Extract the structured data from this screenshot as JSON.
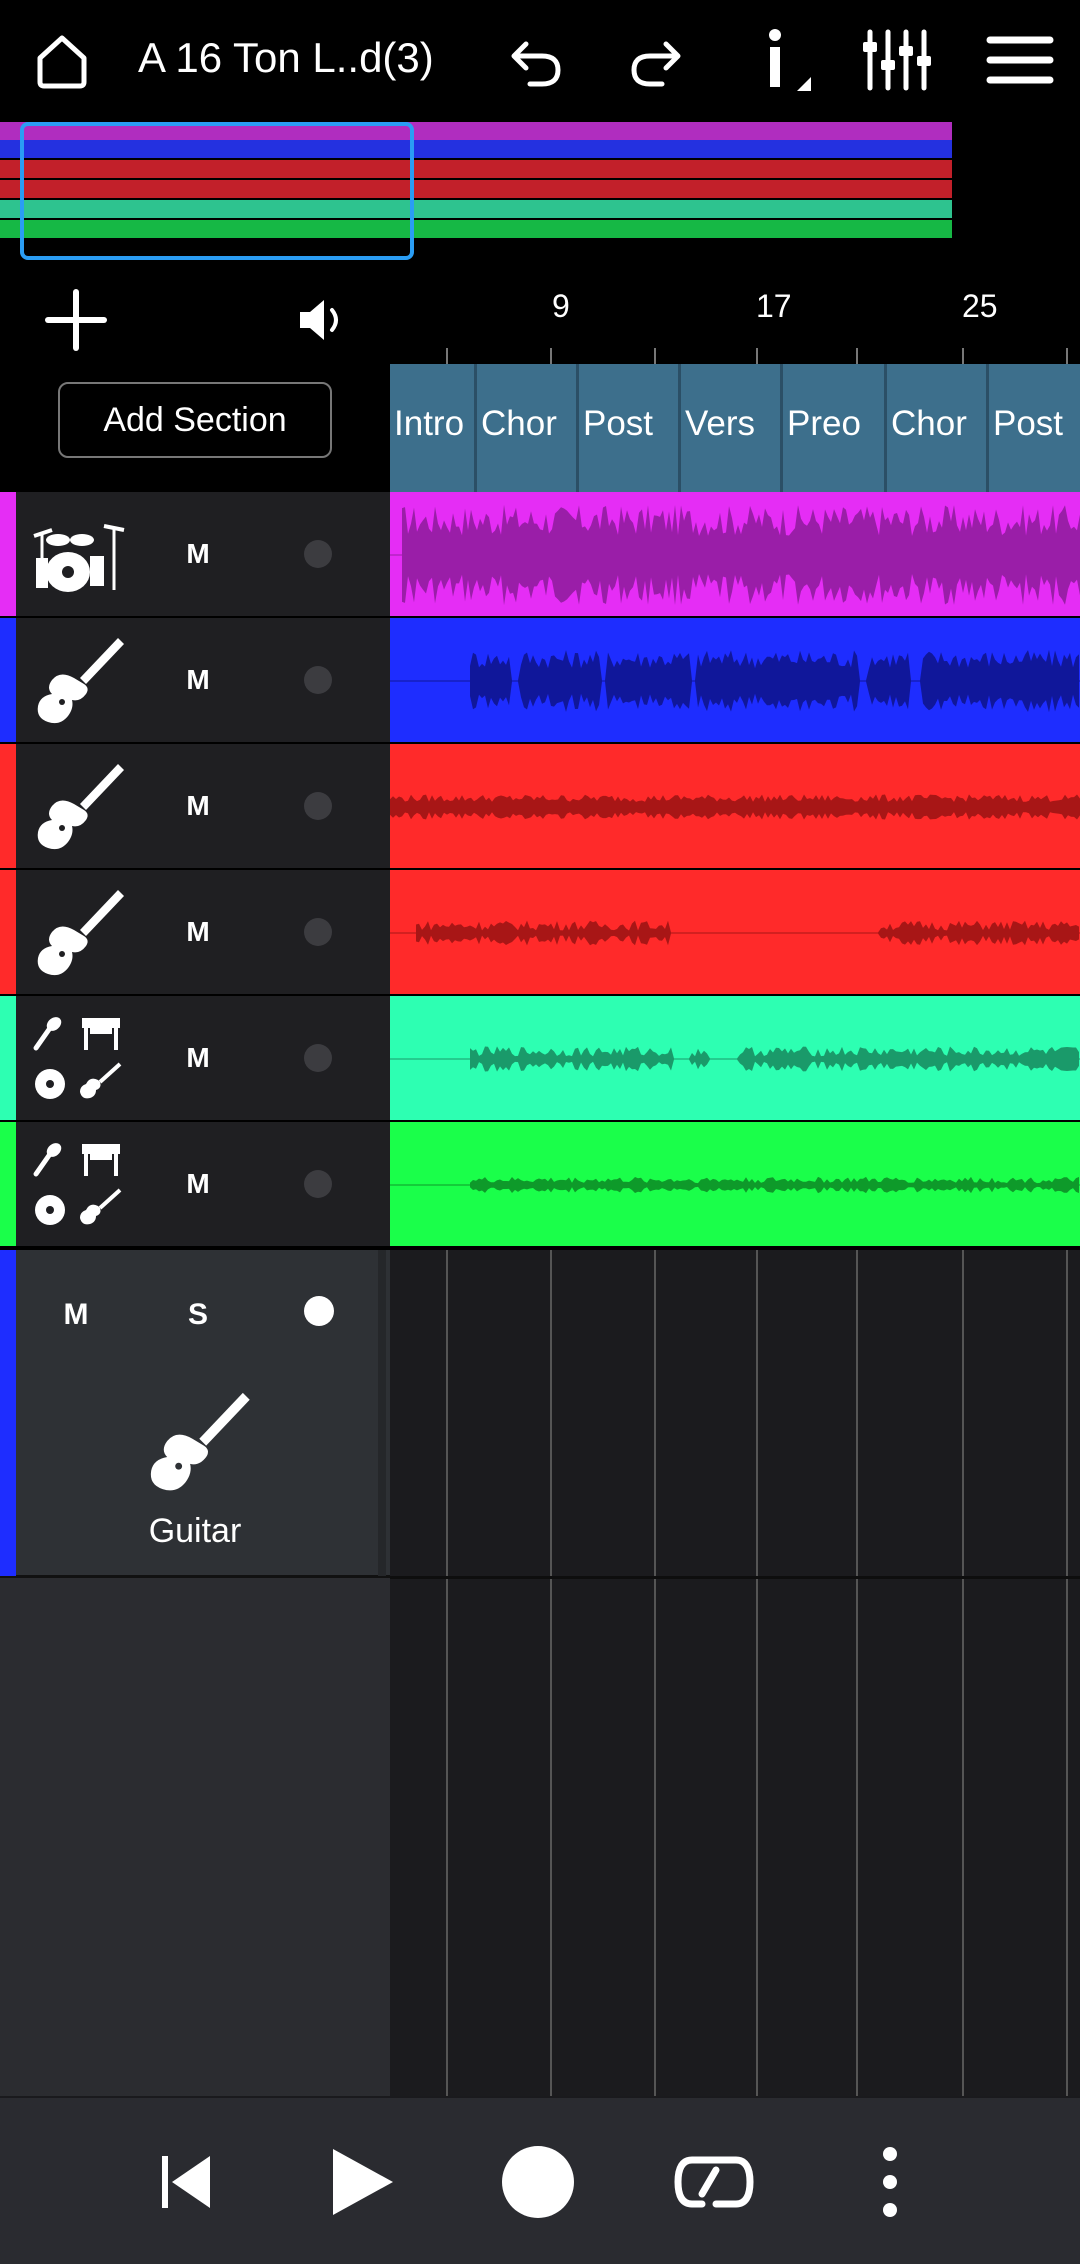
{
  "header": {
    "title": "A 16 Ton L..d(3)",
    "icons": [
      "home-icon",
      "undo-icon",
      "redo-icon",
      "info-icon",
      "mixer-icon",
      "menu-icon"
    ]
  },
  "overview": {
    "track_colors": [
      "#b02dbf",
      "#2431e0",
      "#c2202a",
      "#c2202a",
      "#2ec38f",
      "#16b845"
    ]
  },
  "panel": {
    "add_track_icon": "plus-icon",
    "speaker_icon": "speaker-icon",
    "add_section_label": "Add Section"
  },
  "ruler": {
    "bar_numbers": [
      "9",
      "17",
      "25"
    ]
  },
  "sections": [
    "Intro",
    "Chor",
    "Post",
    "Vers",
    "Preo",
    "Chor",
    "Post"
  ],
  "tracks": [
    {
      "icon": "drums-icon",
      "mute_label": "M",
      "color": "#e52df5",
      "lane_color": "#e52df5",
      "wave_color": "#9a1ea8"
    },
    {
      "icon": "guitar-icon",
      "mute_label": "M",
      "color": "#1e2dff",
      "lane_color": "#1e2dff",
      "wave_color": "#10179a"
    },
    {
      "icon": "guitar-icon",
      "mute_label": "M",
      "color": "#ff2a2a",
      "lane_color": "#ff2a2a",
      "wave_color": "#a81616"
    },
    {
      "icon": "guitar-icon",
      "mute_label": "M",
      "color": "#ff2a2a",
      "lane_color": "#ff2a2a",
      "wave_color": "#a81616"
    },
    {
      "icon": "multi-instrument-icon",
      "mute_label": "M",
      "color": "#2dffb2",
      "lane_color": "#2dffb2",
      "wave_color": "#1a9a6a"
    },
    {
      "icon": "multi-instrument-icon",
      "mute_label": "M",
      "color": "#1aff4a",
      "lane_color": "#1aff4a",
      "wave_color": "#0e9a2a"
    }
  ],
  "selected_track": {
    "mute_label": "M",
    "solo_label": "S",
    "name": "Guitar",
    "icon": "guitar-icon",
    "color": "#1e2dff"
  },
  "transport": {
    "icons": [
      "skip-to-start-icon",
      "play-icon",
      "record-icon",
      "loop-icon",
      "more-icon"
    ]
  }
}
